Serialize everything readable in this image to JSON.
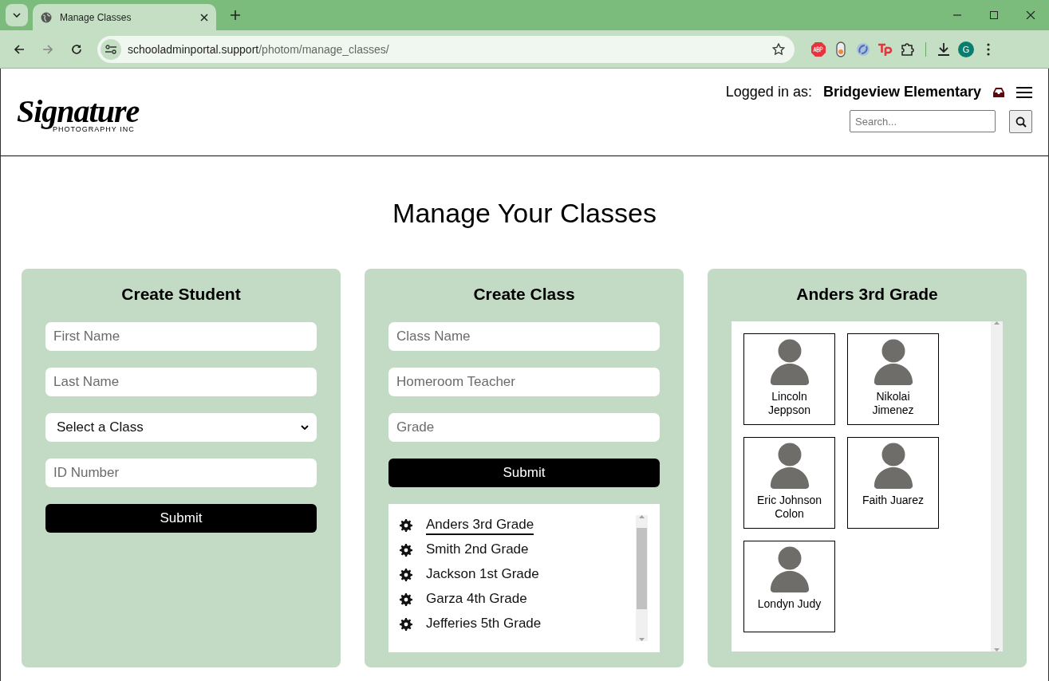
{
  "browser": {
    "tab_title": "Manage Classes",
    "url_host": "schooladminportal.support",
    "url_path": "/photom/manage_classes/",
    "profile_initial": "G"
  },
  "header": {
    "logo": {
      "script": "Signature",
      "tagline": "PHOTOGRAPHY INC"
    },
    "logged_in_label": "Logged in as:",
    "account_name": "Bridgeview Elementary",
    "search": {
      "placeholder": "Search..."
    }
  },
  "page_title": "Manage Your Classes",
  "create_student": {
    "title": "Create Student",
    "fields": [
      {
        "kind": "input",
        "placeholder": "First Name"
      },
      {
        "kind": "input",
        "placeholder": "Last Name"
      },
      {
        "kind": "select",
        "value": "Select a Class"
      },
      {
        "kind": "input",
        "placeholder": "ID Number"
      }
    ],
    "button": "Submit"
  },
  "create_class": {
    "title": "Create Class",
    "fields": [
      {
        "kind": "input",
        "placeholder": "Class Name"
      },
      {
        "kind": "input",
        "placeholder": "Homeroom Teacher"
      },
      {
        "kind": "input",
        "placeholder": "Grade"
      }
    ],
    "button": "Submit",
    "classes": [
      {
        "name": "Anders 3rd Grade",
        "selected": true
      },
      {
        "name": "Smith 2nd Grade",
        "selected": false
      },
      {
        "name": "Jackson 1st Grade",
        "selected": false
      },
      {
        "name": "Garza 4th Grade",
        "selected": false
      },
      {
        "name": "Jefferies 5th Grade",
        "selected": false
      }
    ]
  },
  "roster": {
    "title": "Anders 3rd Grade",
    "students": [
      {
        "name": "Lincoln Jeppson"
      },
      {
        "name": "Nikolai Jimenez"
      },
      {
        "name": "Eric Johnson Colon"
      },
      {
        "name": "Faith Juarez"
      },
      {
        "name": "Londyn Judy"
      }
    ]
  }
}
